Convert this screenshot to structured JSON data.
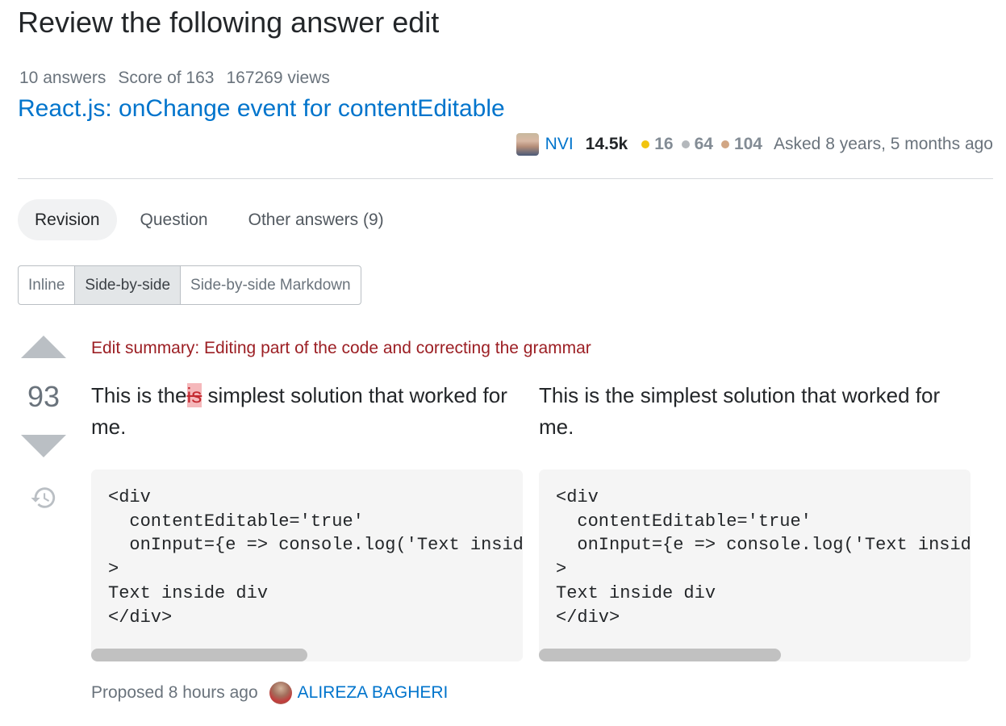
{
  "page": {
    "title": "Review the following answer edit"
  },
  "question": {
    "stats": {
      "answers": "10 answers",
      "score": "Score of 163",
      "views": "167269 views"
    },
    "title": "React.js: onChange event for contentEditable",
    "owner": {
      "name": "NVI",
      "reputation": "14.5k",
      "badges": {
        "gold": {
          "count": "16",
          "color": "#f1c40f"
        },
        "silver": {
          "count": "64",
          "color": "#b4b8bc"
        },
        "bronze": {
          "count": "104",
          "color": "#d1a684"
        }
      },
      "asked": "Asked 8 years, 5 months ago"
    }
  },
  "tabs": [
    {
      "label": "Revision",
      "active": true
    },
    {
      "label": "Question",
      "active": false
    },
    {
      "label": "Other answers (9)",
      "active": false
    }
  ],
  "view_toggle": [
    {
      "label": "Inline",
      "active": false
    },
    {
      "label": "Side-by-side",
      "active": true
    },
    {
      "label": "Side-by-side Markdown",
      "active": false
    }
  ],
  "vote": {
    "score": "93",
    "up_icon": "arrow-up-icon",
    "down_icon": "arrow-down-icon",
    "history_icon": "history-icon"
  },
  "edit": {
    "summary": "Edit summary: Editing part of the code and correcting the grammar",
    "before": {
      "prose_start": "This is the",
      "removed": "is",
      "prose_end": " simplest solution that worked for me.",
      "code": "<div\n  contentEditable='true'\n  onInput={e => console.log('Text inside div', e.currentTarget.textContent)}\n>\nText inside div\n</div>",
      "scroll_fraction": 0.5
    },
    "after": {
      "prose": "This is the simplest solution that worked for me.",
      "code": "<div\n  contentEditable='true'\n  onInput={e => console.log('Text inside div', e.currentTarget.textContent)}\n>\nText inside div\n</div>",
      "scroll_fraction": 0.56
    }
  },
  "proposed": {
    "label": "Proposed 8 hours ago",
    "editor": "ALIREZA BAGHERI"
  }
}
